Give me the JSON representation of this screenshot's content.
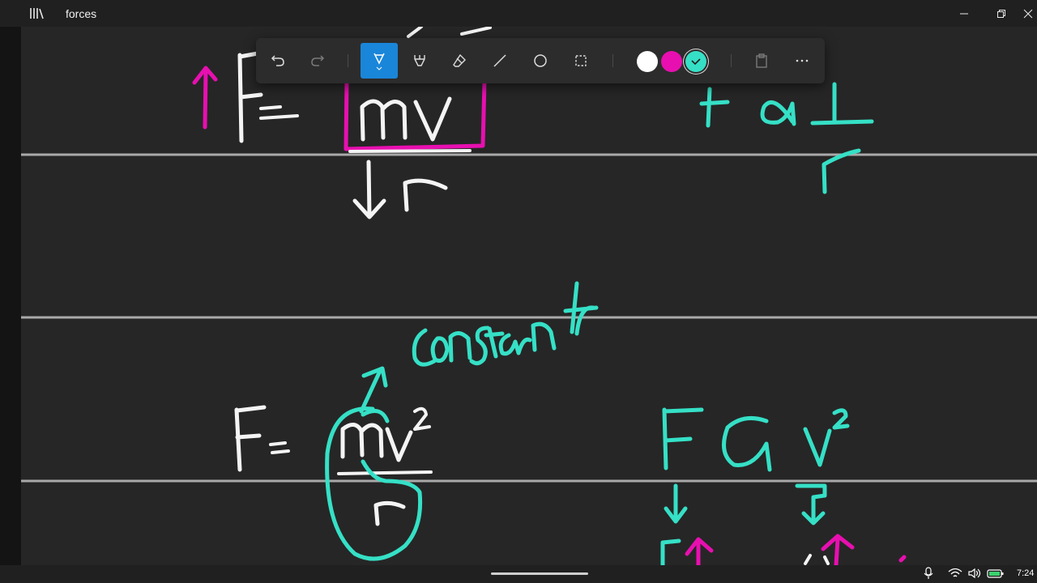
{
  "window": {
    "title": "forces"
  },
  "toolbar": {
    "tools": [
      "undo-icon",
      "redo-icon",
      "pen-icon",
      "highlighter-icon",
      "eraser-icon",
      "line-icon",
      "circle-icon",
      "lasso-select-icon"
    ],
    "active_tool": "pen-icon",
    "colors": [
      "#ffffff",
      "#e80fb0",
      "#35e0c6"
    ],
    "selected_color": "#35e0c6",
    "extra": [
      "paste-icon",
      "more-icon"
    ]
  },
  "canvas": {
    "background": "#262626",
    "rule_color": "#a9a9a9",
    "ink_colors": {
      "white": "#f4f4f4",
      "magenta": "#e80fb0",
      "teal": "#35e0c6"
    },
    "handwriting_text": "constant"
  },
  "taskbar": {
    "time": "7:24"
  }
}
